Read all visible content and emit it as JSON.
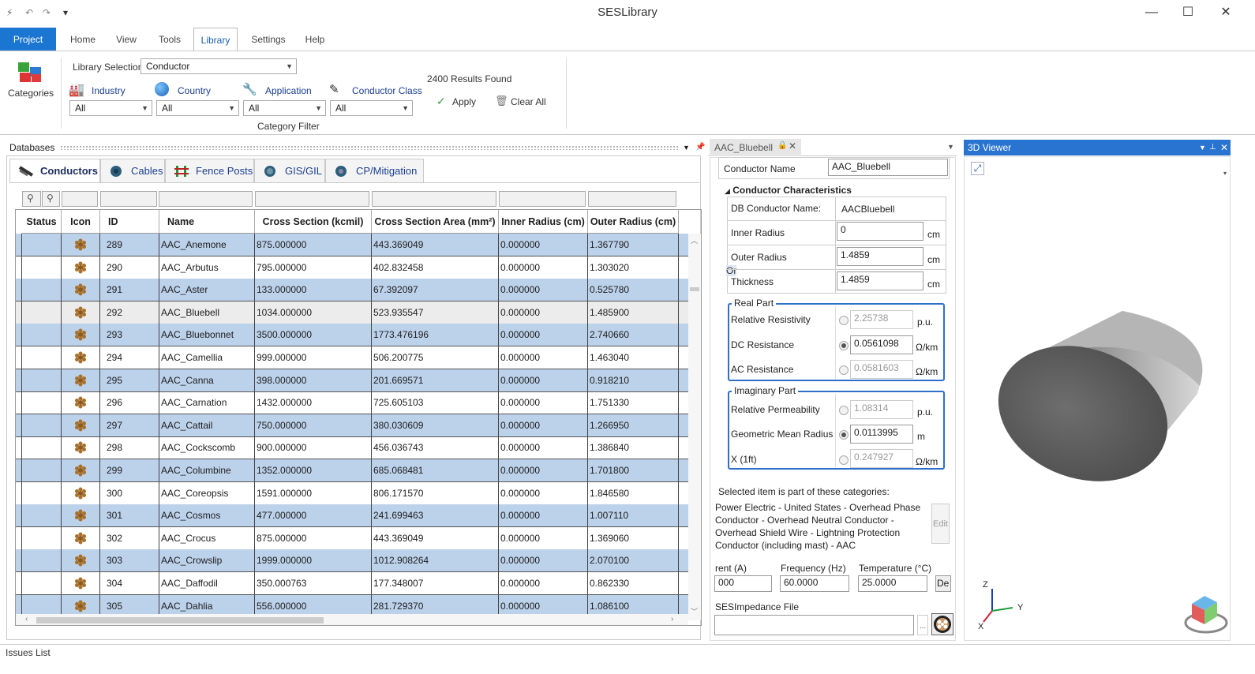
{
  "app": {
    "title": "SESLibrary"
  },
  "ribbon": {
    "tabs": [
      "Project",
      "Home",
      "View",
      "Tools",
      "Library",
      "Settings",
      "Help"
    ],
    "categories_label": "Categories",
    "library_selection_label": "Library Selection:",
    "library_selection_value": "Conductor",
    "filters": [
      {
        "label": "Industry",
        "value": "All"
      },
      {
        "label": "Country",
        "value": "All"
      },
      {
        "label": "Application",
        "value": "All"
      },
      {
        "label": "Conductor Class",
        "value": "All"
      }
    ],
    "category_filter_label": "Category Filter",
    "results_found": "2400 Results Found",
    "apply_label": "Apply",
    "clear_all_label": "Clear All"
  },
  "databases": {
    "panel_title": "Databases",
    "tabs": [
      "Conductors",
      "Cables",
      "Fence Posts",
      "GIS/GIL",
      "CP/Mitigation"
    ],
    "columns": [
      "Status",
      "Icon",
      "ID",
      "Name",
      "Cross Section (kcmil)",
      "Cross Section Area (mm²)",
      "Inner Radius (cm)",
      "Outer Radius (cm)"
    ],
    "rows": [
      {
        "id": "289",
        "name": "AAC_Anemone",
        "cs": "875.000000",
        "csa": "443.369049",
        "inner": "0.000000",
        "outer": "1.367790"
      },
      {
        "id": "290",
        "name": "AAC_Arbutus",
        "cs": "795.000000",
        "csa": "402.832458",
        "inner": "0.000000",
        "outer": "1.303020"
      },
      {
        "id": "291",
        "name": "AAC_Aster",
        "cs": "133.000000",
        "csa": "67.392097",
        "inner": "0.000000",
        "outer": "0.525780"
      },
      {
        "id": "292",
        "name": "AAC_Bluebell",
        "cs": "1034.000000",
        "csa": "523.935547",
        "inner": "0.000000",
        "outer": "1.485900"
      },
      {
        "id": "293",
        "name": "AAC_Bluebonnet",
        "cs": "3500.000000",
        "csa": "1773.476196",
        "inner": "0.000000",
        "outer": "2.740660"
      },
      {
        "id": "294",
        "name": "AAC_Camellia",
        "cs": "999.000000",
        "csa": "506.200775",
        "inner": "0.000000",
        "outer": "1.463040"
      },
      {
        "id": "295",
        "name": "AAC_Canna",
        "cs": "398.000000",
        "csa": "201.669571",
        "inner": "0.000000",
        "outer": "0.918210"
      },
      {
        "id": "296",
        "name": "AAC_Carnation",
        "cs": "1432.000000",
        "csa": "725.605103",
        "inner": "0.000000",
        "outer": "1.751330"
      },
      {
        "id": "297",
        "name": "AAC_Cattail",
        "cs": "750.000000",
        "csa": "380.030609",
        "inner": "0.000000",
        "outer": "1.266950"
      },
      {
        "id": "298",
        "name": "AAC_Cockscomb",
        "cs": "900.000000",
        "csa": "456.036743",
        "inner": "0.000000",
        "outer": "1.386840"
      },
      {
        "id": "299",
        "name": "AAC_Columbine",
        "cs": "1352.000000",
        "csa": "685.068481",
        "inner": "0.000000",
        "outer": "1.701800"
      },
      {
        "id": "300",
        "name": "AAC_Coreopsis",
        "cs": "1591.000000",
        "csa": "806.171570",
        "inner": "0.000000",
        "outer": "1.846580"
      },
      {
        "id": "301",
        "name": "AAC_Cosmos",
        "cs": "477.000000",
        "csa": "241.699463",
        "inner": "0.000000",
        "outer": "1.007110"
      },
      {
        "id": "302",
        "name": "AAC_Crocus",
        "cs": "875.000000",
        "csa": "443.369049",
        "inner": "0.000000",
        "outer": "1.369060"
      },
      {
        "id": "303",
        "name": "AAC_Crowslip",
        "cs": "1999.000000",
        "csa": "1012.908264",
        "inner": "0.000000",
        "outer": "2.070100"
      },
      {
        "id": "304",
        "name": "AAC_Daffodil",
        "cs": "350.000763",
        "csa": "177.348007",
        "inner": "0.000000",
        "outer": "0.862330"
      },
      {
        "id": "305",
        "name": "AAC_Dahlia",
        "cs": "556.000000",
        "csa": "281.729370",
        "inner": "0.000000",
        "outer": "1.086100"
      }
    ]
  },
  "properties": {
    "tab_title": "AAC_Bluebell",
    "conductor_name_label": "Conductor Name",
    "conductor_name_value": "AAC_Bluebell",
    "section_title": "Conductor Characteristics",
    "db_name_label": "DB Conductor Name:",
    "db_name_value": "AACBluebell",
    "inner_radius_label": "Inner Radius",
    "inner_radius_value": "0",
    "outer_radius_label": "Outer Radius",
    "outer_radius_value": "1.4859",
    "overlap_text": "Or",
    "thickness_label": "Thickness",
    "thickness_value": "1.4859",
    "cm": "cm",
    "real_part_title": "Real Part",
    "relative_resistivity_label": "Relative Resistivity",
    "relative_resistivity_value": "2.25738",
    "dc_resistance_label": "DC Resistance",
    "dc_resistance_value": "0.0561098",
    "ac_resistance_label": "AC Resistance",
    "ac_resistance_value": "0.0581603",
    "imag_part_title": "Imaginary Part",
    "relative_permeability_label": "Relative Permeability",
    "relative_permeability_value": "1.08314",
    "gmr_label": "Geometric Mean Radius",
    "gmr_value": "0.0113995",
    "x1ft_label": "X (1ft)",
    "x1ft_value": "0.247927",
    "unit_pu": "p.u.",
    "unit_ohm_km": "Ω/km",
    "unit_m": "m",
    "categories_intro": "Selected item is part of these categories:",
    "categories_text": "Power Electric - United States - Overhead Phase Conductor - Overhead Neutral Conductor - Overhead Shield Wire - Lightning Protection Conductor (including mast) - AAC",
    "edit_label": "Edit",
    "current_label": "rent (A)",
    "current_value": "000",
    "frequency_label": "Frequency (Hz)",
    "frequency_value": "60.0000",
    "temperature_label": "Temperature (°C)",
    "temperature_value": "25.0000",
    "de_label": "De",
    "impedance_file_label": "SESImpedance File",
    "impedance_file_value": "",
    "browse_label": "..."
  },
  "viewer": {
    "title": "3D Viewer",
    "axis_z": "Z",
    "axis_y": "Y",
    "axis_x": "X"
  },
  "status": {
    "issues_list": "Issues List"
  },
  "colors": {
    "accent": "#1b76d2",
    "row_alt": "#bcd1ea",
    "viewer_header": "#2a74d1"
  }
}
